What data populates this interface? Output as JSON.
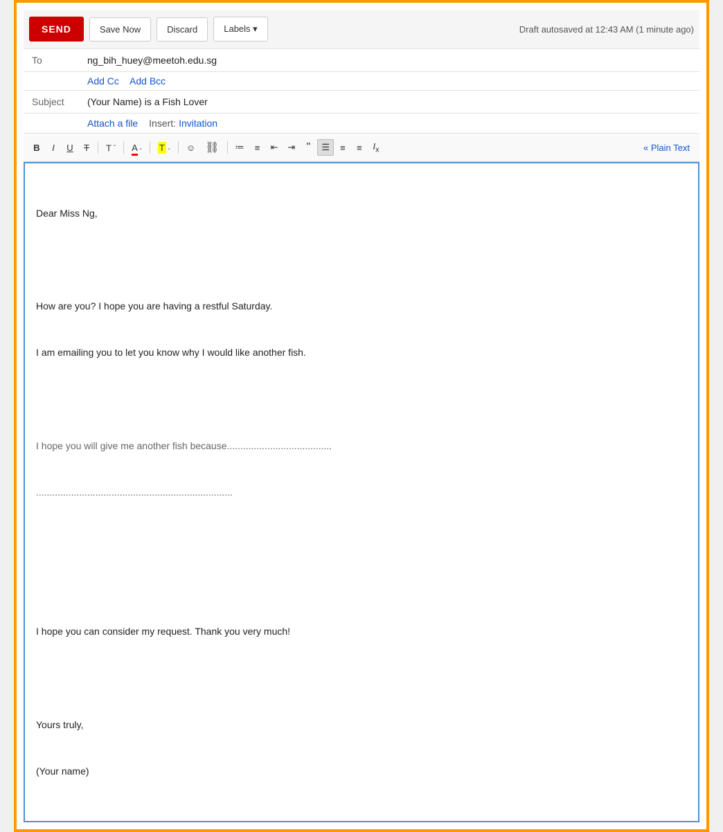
{
  "toolbar": {
    "send_label": "SEND",
    "save_now_label": "Save Now",
    "discard_label": "Discard",
    "labels_label": "Labels ▾",
    "draft_status": "Draft autosaved at 12:43 AM (1 minute ago)"
  },
  "compose": {
    "to_label": "To",
    "to_value": "ng_bih_huey@meetoh.edu.sg",
    "add_cc": "Add Cc",
    "add_bcc": "Add Bcc",
    "subject_label": "Subject",
    "subject_value": "(Your Name) is a Fish Lover",
    "attach_file": "Attach a file",
    "insert_label": "Insert:",
    "invitation_label": "Invitation"
  },
  "formatting": {
    "bold": "B",
    "italic": "I",
    "underline": "U",
    "strikethrough": "T",
    "font_size": "T",
    "font_color": "A",
    "text_bg": "T",
    "emoji": "☺",
    "link": "∞",
    "num_list": "≡",
    "bul_list": "≡",
    "indent_less": "⇤",
    "indent_more": "⇥",
    "quote": "❝",
    "align_center": "≡",
    "align_left": "≡",
    "align_right": "≡",
    "clear_format": "Ix",
    "plain_text": "« Plain Text"
  },
  "body": {
    "line1": "Dear Miss Ng,",
    "line2": "",
    "line3": "How are you? I hope you are having a restful Saturday.",
    "line4": "I am emailing you to let you know why I would like another fish.",
    "line5": "",
    "line6": "I hope you will give me another fish because.......................................",
    "line7": ".........................................................................",
    "line8": "",
    "line9": "",
    "line10": "I hope you can consider my request. Thank you very much!",
    "line11": "",
    "line12": "Yours truly,",
    "line13": "(Your name)"
  }
}
